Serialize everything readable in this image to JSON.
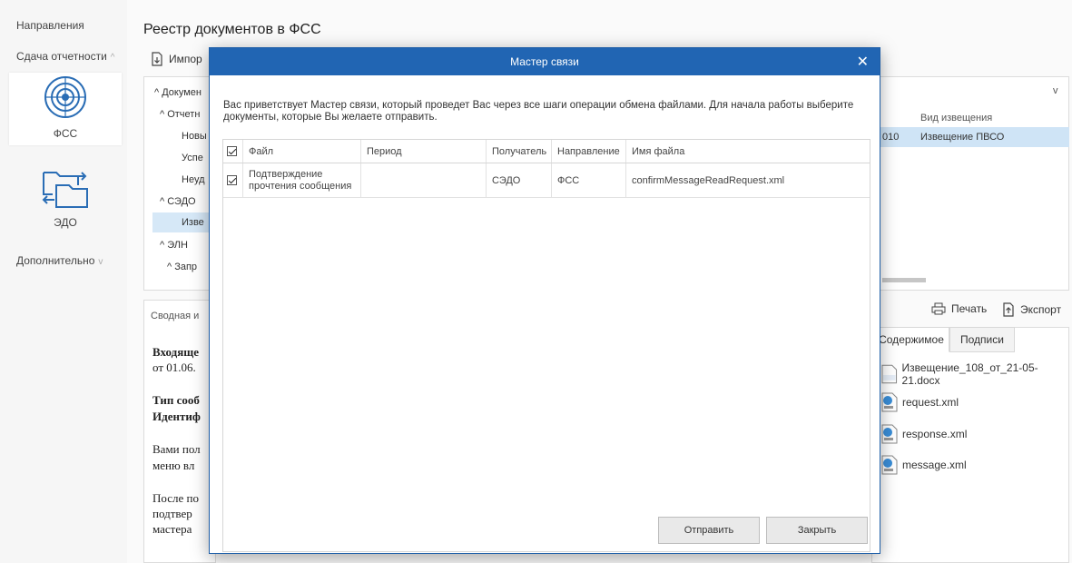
{
  "nav": {
    "section_label": "Направления",
    "reporting_label": "Сдача отчетности",
    "fss_label": "ФСС",
    "edo_label": "ЭДО",
    "extra_label": "Дополнительно"
  },
  "page": {
    "title": "Реестр документов в ФСС",
    "import_label": "Импор"
  },
  "tree": [
    "^ Докумен",
    "^ Отчетн",
    "Новы",
    "Успе",
    "Неуд",
    "^ СЭДО",
    "Изве",
    "^ ЭЛН",
    "^ Запр"
  ],
  "right_table": {
    "col_partial": "010",
    "col_header": "Вид извещения",
    "row_value": "Извещение ПВСО"
  },
  "summary_tab": "Сводная и",
  "tools": {
    "print": "Печать",
    "export": "Экспорт"
  },
  "tabs": {
    "content": "Содержимое",
    "signatures": "Подписи"
  },
  "files": [
    "Извещение_108_от_21-05-21.docx",
    "request.xml",
    "response.xml",
    "message.xml"
  ],
  "doc_lines": [
    "Входяще",
    "от 01.06.",
    "Тип сооб",
    "Идентиф",
    "Вами пол",
    "меню вл",
    "После по",
    "подтвер",
    "мастера"
  ],
  "modal": {
    "title": "Мастер связи",
    "intro": "Вас приветствует Мастер связи, который проведет Вас через все шаги операции обмена файлами. Для начала работы выберите документы, которые Вы желаете отправить.",
    "columns": {
      "file": "Файл",
      "period": "Период",
      "recipient": "Получатель",
      "direction": "Направление",
      "filename": "Имя файла"
    },
    "rows": [
      {
        "file": "Подтверждение прочтения сообщения",
        "period": "",
        "recipient": "СЭДО",
        "direction": "ФСС",
        "filename": "confirmMessageReadRequest.xml"
      }
    ],
    "send_label": "Отправить",
    "close_label": "Закрыть"
  }
}
